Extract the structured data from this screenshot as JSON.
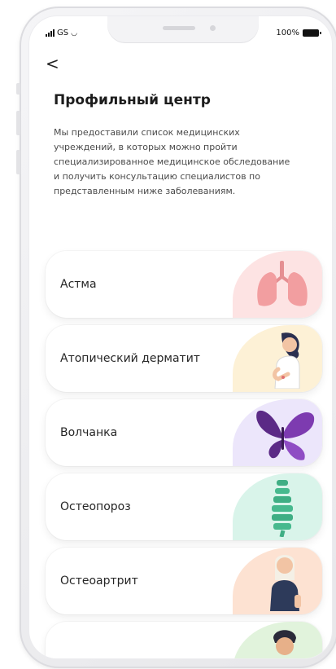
{
  "status_bar": {
    "carrier": "GS",
    "battery": "100%"
  },
  "header": {
    "back_label": "<"
  },
  "title": "Профильный центр",
  "description": "Мы предоставили список медицинских учреждений, в которых можно пройти специализированное медицинское обследование и получить консультацию специалистов по представленным ниже заболеваниям.",
  "diseases": [
    {
      "label": "Астма",
      "icon": "lungs-icon",
      "bg": "#fde3e3"
    },
    {
      "label": "Атопический дерматит",
      "icon": "woman-scratching-icon",
      "bg": "#fdf1d6"
    },
    {
      "label": "Волчанка",
      "icon": "butterfly-icon",
      "bg": "#ece6fb"
    },
    {
      "label": "Остеопороз",
      "icon": "spine-icon",
      "bg": "#d9f4ea"
    },
    {
      "label": "Остеоартрит",
      "icon": "woman-knee-pain-icon",
      "bg": "#fde2d2"
    },
    {
      "label": "",
      "icon": "man-avatar-icon",
      "bg": "#e1f3dc"
    }
  ]
}
